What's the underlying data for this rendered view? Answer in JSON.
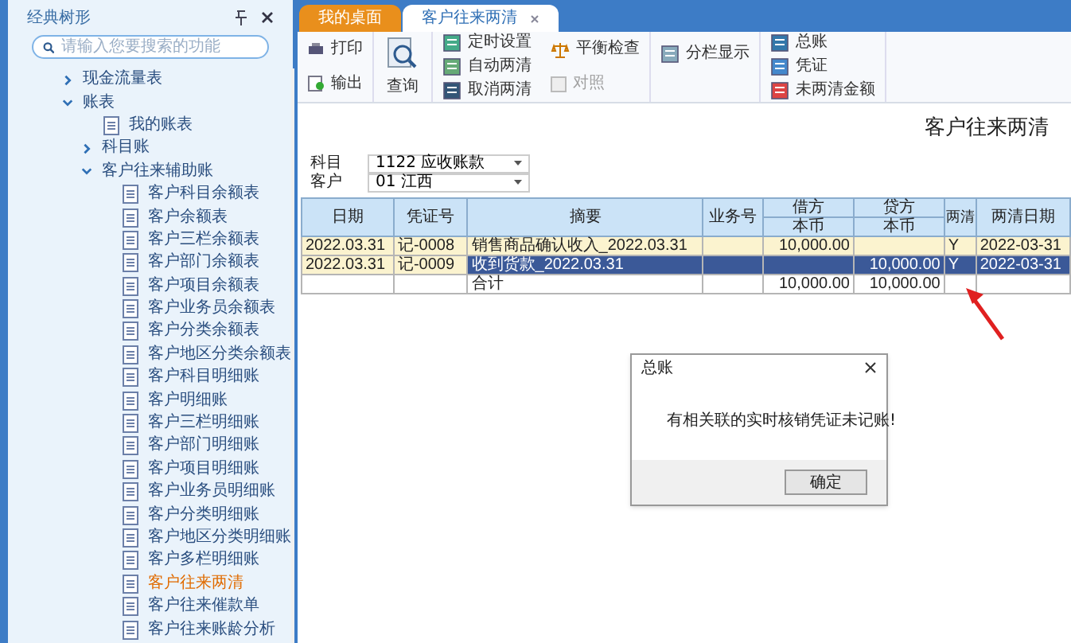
{
  "sidebar": {
    "title": "经典树形",
    "search": {
      "placeholder": "请输入您要搜索的功能"
    },
    "tree": [
      {
        "label": "现金流量表",
        "expanded": false
      },
      {
        "label": "账表",
        "expanded": true,
        "children": [
          {
            "label": "我的账表",
            "selected": false
          },
          {
            "label": "科目账",
            "expanded": false
          },
          {
            "label": "客户往来辅助账",
            "expanded": true,
            "children": [
              {
                "label": "客户科目余额表",
                "selected": false
              },
              {
                "label": "客户余额表",
                "selected": false
              },
              {
                "label": "客户三栏余额表",
                "selected": false
              },
              {
                "label": "客户部门余额表",
                "selected": false
              },
              {
                "label": "客户项目余额表",
                "selected": false
              },
              {
                "label": "客户业务员余额表",
                "selected": false
              },
              {
                "label": "客户分类余额表",
                "selected": false
              },
              {
                "label": "客户地区分类余额表",
                "selected": false
              },
              {
                "label": "客户科目明细账",
                "selected": false
              },
              {
                "label": "客户明细账",
                "selected": false
              },
              {
                "label": "客户三栏明细账",
                "selected": false
              },
              {
                "label": "客户部门明细账",
                "selected": false
              },
              {
                "label": "客户项目明细账",
                "selected": false
              },
              {
                "label": "客户业务员明细账",
                "selected": false
              },
              {
                "label": "客户分类明细账",
                "selected": false
              },
              {
                "label": "客户地区分类明细账",
                "selected": false
              },
              {
                "label": "客户多栏明细账",
                "selected": false
              },
              {
                "label": "客户往来两清",
                "selected": true
              },
              {
                "label": "客户往来催款单",
                "selected": false
              },
              {
                "label": "客户往来账龄分析",
                "selected": false
              }
            ]
          }
        ]
      }
    ]
  },
  "tabs": [
    {
      "label": "我的桌面",
      "selected": false,
      "closable": false
    },
    {
      "label": "客户往来两清",
      "selected": true,
      "closable": true
    }
  ],
  "toolbar": {
    "print": "打印",
    "export": "输出",
    "query": "查询",
    "timer": "定时设置",
    "auto_clear": "自动两清",
    "cancel_clear": "取消两清",
    "balance_check": "平衡检查",
    "reconcile": {
      "label": "对照",
      "disabled": true
    },
    "split_view": "分栏显示",
    "ledger": "总账",
    "voucher": "凭证",
    "uncleared_amount": "未两清金额"
  },
  "report": {
    "title": "客户往来两清",
    "filters": [
      {
        "label": "科目",
        "value": "1122 应收账款"
      },
      {
        "label": "客户",
        "value": "01 江西"
      }
    ]
  },
  "table": {
    "columns": [
      "日期",
      "凭证号",
      "摘要",
      "业务号",
      "借方",
      "贷方",
      "两清",
      "两清日期"
    ],
    "subcolumns": [
      "本币",
      "本币"
    ],
    "rows": [
      {
        "cells": [
          "2022.03.31",
          "记-0008",
          "销售商品确认收入_2022.03.31",
          "",
          "10,000.00",
          "",
          "Y",
          "2022-03-31"
        ],
        "selected": false
      },
      {
        "cells": [
          "2022.03.31",
          "记-0009",
          "收到货款_2022.03.31",
          "",
          "",
          "10,000.00",
          "Y",
          "2022-03-31"
        ],
        "selected": true
      },
      {
        "cells": [
          "",
          "",
          "合计",
          "",
          "10,000.00",
          "10,000.00",
          "",
          ""
        ],
        "selected": false
      }
    ]
  },
  "dialog": {
    "title": "总账",
    "message": "有相关联的实时核销凭证未记账!",
    "button": "确定"
  }
}
